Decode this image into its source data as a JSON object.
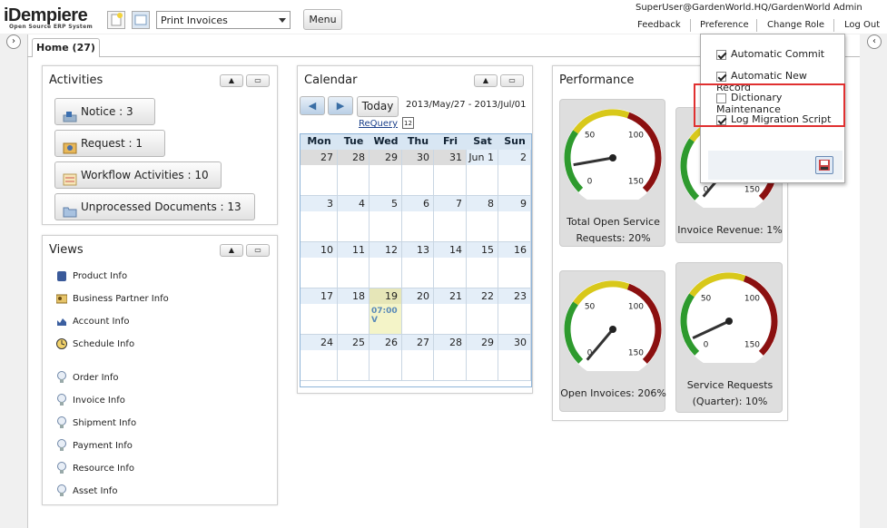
{
  "header": {
    "logo": "iDempiere",
    "logo_sub": "Open Source ERP System",
    "process_select": "Print Invoices",
    "menu_label": "Menu",
    "user": "SuperUser@GardenWorld.HQ/GardenWorld Admin",
    "links": [
      "Feedback",
      "Preference",
      "Change Role",
      "Log Out"
    ]
  },
  "tab": {
    "home": "Home (27)"
  },
  "activities": {
    "title": "Activities",
    "items": [
      "Notice : 3",
      "Request : 1",
      "Workflow Activities : 10",
      "Unprocessed Documents : 13"
    ]
  },
  "views": {
    "title": "Views",
    "items": [
      "Product Info",
      "Business Partner Info",
      "Account Info",
      "Schedule Info",
      "Order Info",
      "Invoice Info",
      "Shipment Info",
      "Payment Info",
      "Resource Info",
      "Asset Info"
    ]
  },
  "calendar": {
    "title": "Calendar",
    "today": "Today",
    "range": "2013/May/27 - 2013/Jul/01",
    "requery": "ReQuery",
    "day_headers": [
      "Mon",
      "Tue",
      "Wed",
      "Thu",
      "Fri",
      "Sat",
      "Sun"
    ],
    "weeks": [
      [
        "27",
        "28",
        "29",
        "30",
        "31",
        "Jun 1",
        "2"
      ],
      [
        "3",
        "4",
        "5",
        "6",
        "7",
        "8",
        "9"
      ],
      [
        "10",
        "11",
        "12",
        "13",
        "14",
        "15",
        "16"
      ],
      [
        "17",
        "18",
        "19",
        "20",
        "21",
        "22",
        "23"
      ],
      [
        "24",
        "25",
        "26",
        "27",
        "28",
        "29",
        "30"
      ]
    ],
    "event": "07:00 V"
  },
  "performance": {
    "title": "Performance",
    "gauges": [
      {
        "label": "Total Open Service Requests: 20%"
      },
      {
        "label": "Invoice Revenue: 1%"
      },
      {
        "label": "Open Invoices: 206%"
      },
      {
        "label": "Service Requests (Quarter): 10%"
      }
    ],
    "ticks": [
      "0",
      "50",
      "100",
      "150"
    ]
  },
  "preferences": {
    "items": [
      {
        "label": "Automatic Commit",
        "checked": true
      },
      {
        "label": "Automatic New Record",
        "checked": true
      },
      {
        "label": "Dictionary Maintenance",
        "checked": false
      },
      {
        "label": "Log Migration Script",
        "checked": true
      }
    ]
  },
  "colors": {
    "highlight": "#e03030",
    "calendar_header": "#d8e6f3",
    "today": "#f4f4c8"
  }
}
